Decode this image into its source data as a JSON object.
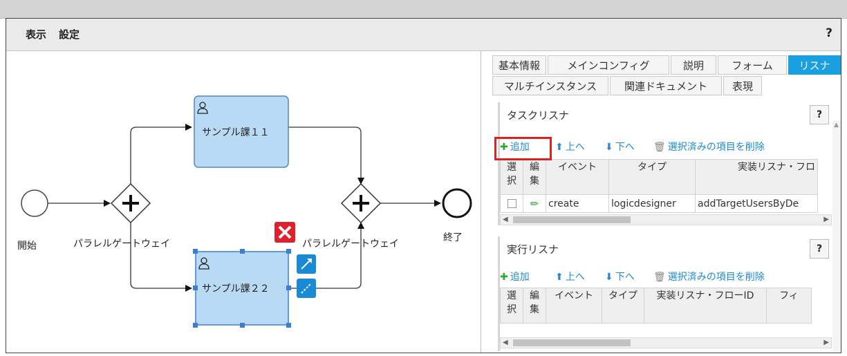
{
  "menu": {
    "view": "表示",
    "settings": "設定",
    "help": "?"
  },
  "diagram": {
    "start_label": "開始",
    "end_label": "終了",
    "gateway1_label": "パラレルゲートウェイ",
    "gateway2_label": "パラレルゲートウェイ",
    "task1_label": "サンプル課１１",
    "task2_label": "サンプル課２２",
    "colors": {
      "task_fill": "#b9daf5",
      "task_border": "#5b84b2",
      "selected_border": "#3a7fd1",
      "delete_red": "#e0202c",
      "tool_blue": "#1a8ad6"
    }
  },
  "tabs": {
    "row1": [
      "基本情報",
      "メインコンフィグ",
      "説明",
      "フォーム",
      "リスナ"
    ],
    "row2": [
      "マルチインスタンス",
      "関連ドキュメント",
      "表現"
    ],
    "active": "リスナ"
  },
  "task_listener": {
    "title": "タスクリスナ",
    "help": "?",
    "toolbar": {
      "add": "追加",
      "up": "上へ",
      "down": "下へ",
      "delete": "選択済みの項目を削除"
    },
    "columns": [
      "選択",
      "編集",
      "イベント",
      "タイプ",
      "実装リスナ・フロ"
    ],
    "rows": [
      {
        "event": "create",
        "type": "logicdesigner",
        "impl": "addTargetUsersByDe"
      }
    ]
  },
  "exec_listener": {
    "title": "実行リスナ",
    "help": "?",
    "toolbar": {
      "add": "追加",
      "up": "上へ",
      "down": "下へ",
      "delete": "選択済みの項目を削除"
    },
    "columns": [
      "選択",
      "編集",
      "イベント",
      "タイプ",
      "実装リスナ・フローID",
      "フィ"
    ]
  }
}
